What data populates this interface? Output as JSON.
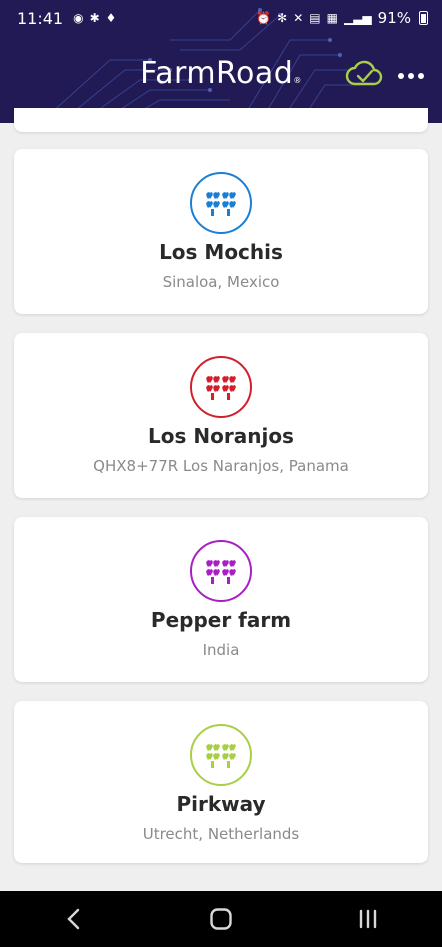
{
  "status_bar": {
    "time": "11:41",
    "battery": "91%"
  },
  "header": {
    "logo": "FarmRoad",
    "logo_mark": "®",
    "sync_icon": "cloud-check-icon",
    "more_icon": "more-dots-icon"
  },
  "farms": [
    {
      "name": "Los Mochis",
      "location": "Sinaloa, Mexico",
      "color": "#1a7fd4"
    },
    {
      "name": "Los Noranjos",
      "location": "QHX8+77R Los Naranjos, Panama",
      "color": "#d21f2b"
    },
    {
      "name": "Pepper farm",
      "location": "India",
      "color": "#a81fc4"
    },
    {
      "name": "Pirkway",
      "location": "Utrecht, Netherlands",
      "color": "#a8cf45"
    }
  ],
  "colors": {
    "header_bg": "#221a55",
    "accent_green": "#a8cf45"
  }
}
